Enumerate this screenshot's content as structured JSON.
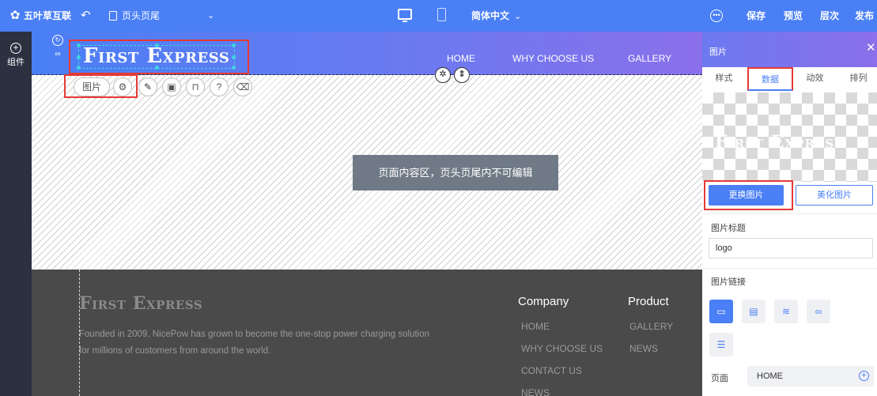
{
  "topbar": {
    "brand": "五叶草互联",
    "page_select": "页头页尾",
    "language": "简体中文",
    "save": "保存",
    "preview": "预览",
    "layers": "层次",
    "publish": "发布"
  },
  "leftrail": {
    "components_label": "组件"
  },
  "site_header": {
    "logo_text": "First Express",
    "nav": [
      "HOME",
      "WHY CHOOSE US",
      "GALLERY"
    ]
  },
  "element_toolbar": {
    "label": "图片"
  },
  "content_area": {
    "message": "页面内容区，页头页尾内不可编辑"
  },
  "site_footer": {
    "logo_text": "First Express",
    "description_line1": "Founded in 2009, NicePow has grown to become the one-stop power charging solution",
    "description_line2": "for millions of customers from around the world.",
    "company": {
      "title": "Company",
      "links": [
        "HOME",
        "WHY CHOOSE US",
        "CONTACT US",
        "NEWS"
      ]
    },
    "product": {
      "title": "Product",
      "links": [
        "GALLERY",
        "NEWS"
      ]
    }
  },
  "panel": {
    "title": "图片",
    "tabs": [
      "样式",
      "数据",
      "动效",
      "排列"
    ],
    "active_tab": "数据",
    "preview_text": "First Express",
    "change_image": "更换图片",
    "beautify_image": "美化图片",
    "image_title_label": "图片标题",
    "image_title_value": "logo",
    "image_link_label": "图片链接",
    "page_label": "页面",
    "page_value": "HOME"
  },
  "colors": {
    "accent": "#4a7ff5",
    "highlight": "#e53935",
    "footer_bg": "#4a4a4a",
    "rail_bg": "#2b3140"
  }
}
